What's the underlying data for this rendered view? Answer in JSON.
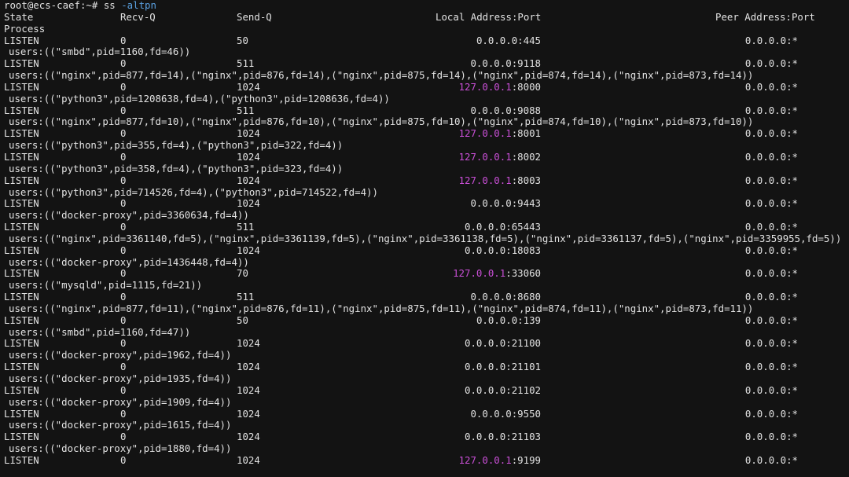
{
  "terminal": {
    "prompt": "root@ecs-caef:~#",
    "command": "ss",
    "flags": "-altpn",
    "colors": {
      "background": "#131313",
      "text": "#e2e2e2",
      "loopback_highlight": "#c94fd6",
      "flag_highlight": "#5aa0e0"
    },
    "header": {
      "state": "State",
      "recv_q": "Recv-Q",
      "send_q": "Send-Q",
      "local": "Local Address:Port",
      "peer": "Peer Address:Port",
      "process": "Process"
    },
    "rows": [
      {
        "state": "LISTEN",
        "recv": "0",
        "send": "50",
        "ip": "0.0.0.0",
        "port": ":445",
        "peer": "0.0.0.0:*",
        "users": "users:((\"smbd\",pid=1160,fd=46))"
      },
      {
        "state": "LISTEN",
        "recv": "0",
        "send": "511",
        "ip": "0.0.0.0",
        "port": ":9118",
        "peer": "0.0.0.0:*",
        "users": "users:((\"nginx\",pid=877,fd=14),(\"nginx\",pid=876,fd=14),(\"nginx\",pid=875,fd=14),(\"nginx\",pid=874,fd=14),(\"nginx\",pid=873,fd=14))"
      },
      {
        "state": "LISTEN",
        "recv": "0",
        "send": "1024",
        "ip": "127.0.0.1",
        "port": ":8000",
        "peer": "0.0.0.0:*",
        "users": "users:((\"python3\",pid=1208638,fd=4),(\"python3\",pid=1208636,fd=4))"
      },
      {
        "state": "LISTEN",
        "recv": "0",
        "send": "511",
        "ip": "0.0.0.0",
        "port": ":9088",
        "peer": "0.0.0.0:*",
        "users": "users:((\"nginx\",pid=877,fd=10),(\"nginx\",pid=876,fd=10),(\"nginx\",pid=875,fd=10),(\"nginx\",pid=874,fd=10),(\"nginx\",pid=873,fd=10))"
      },
      {
        "state": "LISTEN",
        "recv": "0",
        "send": "1024",
        "ip": "127.0.0.1",
        "port": ":8001",
        "peer": "0.0.0.0:*",
        "users": "users:((\"python3\",pid=355,fd=4),(\"python3\",pid=322,fd=4))"
      },
      {
        "state": "LISTEN",
        "recv": "0",
        "send": "1024",
        "ip": "127.0.0.1",
        "port": ":8002",
        "peer": "0.0.0.0:*",
        "users": "users:((\"python3\",pid=358,fd=4),(\"python3\",pid=323,fd=4))"
      },
      {
        "state": "LISTEN",
        "recv": "0",
        "send": "1024",
        "ip": "127.0.0.1",
        "port": ":8003",
        "peer": "0.0.0.0:*",
        "users": "users:((\"python3\",pid=714526,fd=4),(\"python3\",pid=714522,fd=4))"
      },
      {
        "state": "LISTEN",
        "recv": "0",
        "send": "1024",
        "ip": "0.0.0.0",
        "port": ":9443",
        "peer": "0.0.0.0:*",
        "users": "users:((\"docker-proxy\",pid=3360634,fd=4))"
      },
      {
        "state": "LISTEN",
        "recv": "0",
        "send": "511",
        "ip": "0.0.0.0",
        "port": ":65443",
        "peer": "0.0.0.0:*",
        "users": "users:((\"nginx\",pid=3361140,fd=5),(\"nginx\",pid=3361139,fd=5),(\"nginx\",pid=3361138,fd=5),(\"nginx\",pid=3361137,fd=5),(\"nginx\",pid=3359955,fd=5))"
      },
      {
        "state": "LISTEN",
        "recv": "0",
        "send": "1024",
        "ip": "0.0.0.0",
        "port": ":18083",
        "peer": "0.0.0.0:*",
        "users": "users:((\"docker-proxy\",pid=1436448,fd=4))"
      },
      {
        "state": "LISTEN",
        "recv": "0",
        "send": "70",
        "ip": "127.0.0.1",
        "port": ":33060",
        "peer": "0.0.0.0:*",
        "users": "users:((\"mysqld\",pid=1115,fd=21))"
      },
      {
        "state": "LISTEN",
        "recv": "0",
        "send": "511",
        "ip": "0.0.0.0",
        "port": ":8680",
        "peer": "0.0.0.0:*",
        "users": "users:((\"nginx\",pid=877,fd=11),(\"nginx\",pid=876,fd=11),(\"nginx\",pid=875,fd=11),(\"nginx\",pid=874,fd=11),(\"nginx\",pid=873,fd=11))"
      },
      {
        "state": "LISTEN",
        "recv": "0",
        "send": "50",
        "ip": "0.0.0.0",
        "port": ":139",
        "peer": "0.0.0.0:*",
        "users": "users:((\"smbd\",pid=1160,fd=47))"
      },
      {
        "state": "LISTEN",
        "recv": "0",
        "send": "1024",
        "ip": "0.0.0.0",
        "port": ":21100",
        "peer": "0.0.0.0:*",
        "users": "users:((\"docker-proxy\",pid=1962,fd=4))"
      },
      {
        "state": "LISTEN",
        "recv": "0",
        "send": "1024",
        "ip": "0.0.0.0",
        "port": ":21101",
        "peer": "0.0.0.0:*",
        "users": "users:((\"docker-proxy\",pid=1935,fd=4))"
      },
      {
        "state": "LISTEN",
        "recv": "0",
        "send": "1024",
        "ip": "0.0.0.0",
        "port": ":21102",
        "peer": "0.0.0.0:*",
        "users": "users:((\"docker-proxy\",pid=1909,fd=4))"
      },
      {
        "state": "LISTEN",
        "recv": "0",
        "send": "1024",
        "ip": "0.0.0.0",
        "port": ":9550",
        "peer": "0.0.0.0:*",
        "users": "users:((\"docker-proxy\",pid=1615,fd=4))"
      },
      {
        "state": "LISTEN",
        "recv": "0",
        "send": "1024",
        "ip": "0.0.0.0",
        "port": ":21103",
        "peer": "0.0.0.0:*",
        "users": "users:((\"docker-proxy\",pid=1880,fd=4))"
      },
      {
        "state": "LISTEN",
        "recv": "0",
        "send": "1024",
        "ip": "127.0.0.1",
        "port": ":9199",
        "peer": "0.0.0.0:*",
        "users": ""
      }
    ]
  }
}
